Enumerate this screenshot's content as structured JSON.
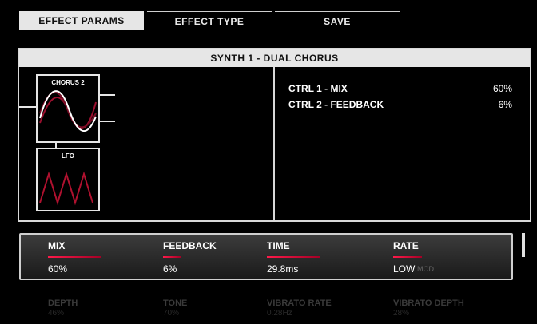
{
  "tabs": [
    {
      "label": "EFFECT PARAMS",
      "active": true
    },
    {
      "label": "EFFECT TYPE",
      "active": false
    },
    {
      "label": "SAVE",
      "active": false
    }
  ],
  "panel": {
    "title": "SYNTH 1 - DUAL CHORUS",
    "diagram": {
      "chorus_label": "CHORUS 2",
      "lfo_label": "LFO"
    },
    "controls": [
      {
        "label": "CTRL 1  -  MIX",
        "value": "60%"
      },
      {
        "label": "CTRL 2  -  FEEDBACK",
        "value": "6%"
      }
    ]
  },
  "params": [
    {
      "label": "MIX",
      "value": "60%",
      "level": 0.55
    },
    {
      "label": "FEEDBACK",
      "value": "6%",
      "level": 0.06
    },
    {
      "label": "TIME",
      "value": "29.8ms",
      "level": 0.55
    },
    {
      "label": "RATE",
      "value": "LOW",
      "sub": "MOD",
      "level": 0.3
    }
  ],
  "params_next": [
    {
      "label": "DEPTH",
      "value": "46%"
    },
    {
      "label": "TONE",
      "value": "70%"
    },
    {
      "label": "VIBRATO RATE",
      "value": "0.28Hz"
    },
    {
      "label": "VIBRATO DEPTH",
      "value": "28%"
    }
  ],
  "colors": {
    "accent": "#d4143c",
    "panel_border": "#d9d9d9",
    "header_bg": "#e6e6e6"
  }
}
